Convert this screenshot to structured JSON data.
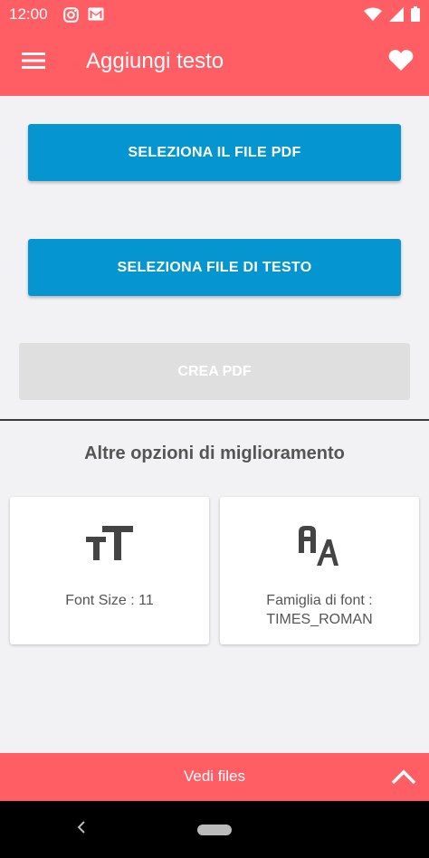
{
  "status_bar": {
    "time": "12:00"
  },
  "app_bar": {
    "title": "Aggiungi testo"
  },
  "actions": {
    "select_pdf": "SELEZIONA IL FILE PDF",
    "select_text": "SELEZIONA FILE DI TESTO",
    "create_pdf": "CREA PDF"
  },
  "options": {
    "title": "Altre opzioni di miglioramento",
    "font_size_label": "Font Size : 11",
    "font_family_label": "Famiglia di font : TIMES_ROMAN"
  },
  "bottom_bar": {
    "label": "Vedi files"
  },
  "colors": {
    "accent": "#fe5e64",
    "primary_button": "#0596d2",
    "disabled_button": "#dfdfdf"
  },
  "icons": [
    "menu-icon",
    "heart-icon",
    "instagram-icon",
    "gmail-icon",
    "wifi-icon",
    "signal-icon",
    "battery-icon",
    "text-size-icon",
    "font-family-icon",
    "chevron-up-icon",
    "back-icon",
    "home-icon"
  ]
}
